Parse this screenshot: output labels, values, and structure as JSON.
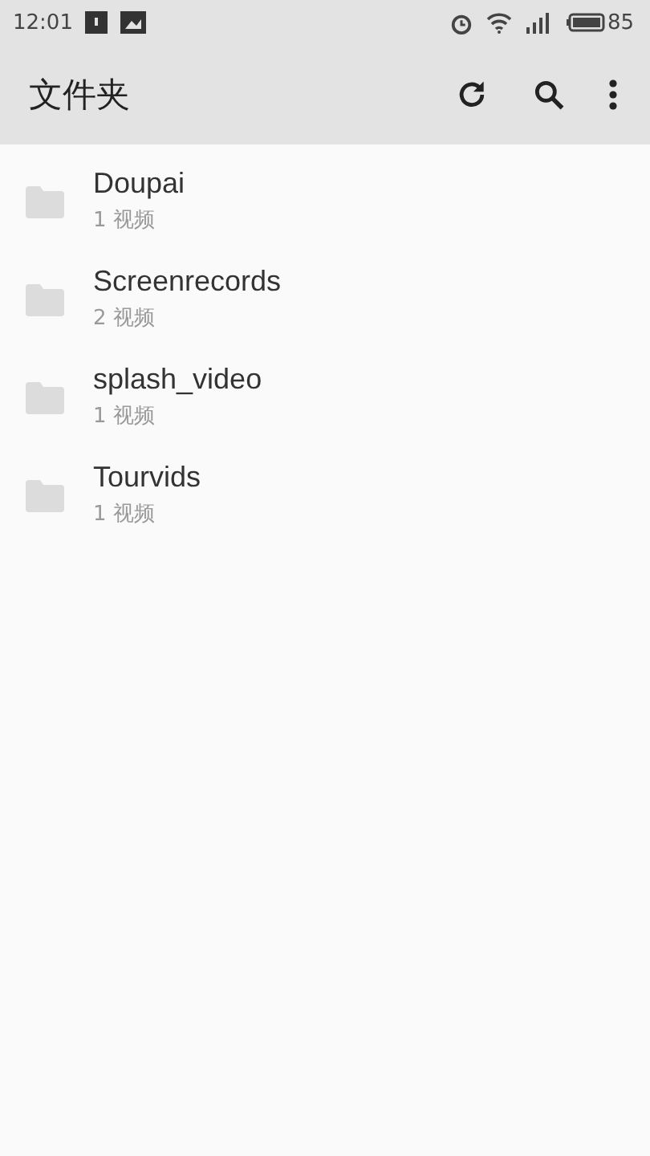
{
  "status_bar": {
    "time": "12:01",
    "battery": "85"
  },
  "toolbar": {
    "title": "文件夹"
  },
  "folders": [
    {
      "name": "Doupai",
      "count": "1 视频"
    },
    {
      "name": "Screenrecords",
      "count": "2 视频"
    },
    {
      "name": "splash_video",
      "count": "1 视频"
    },
    {
      "name": "Tourvids",
      "count": "1 视频"
    }
  ]
}
